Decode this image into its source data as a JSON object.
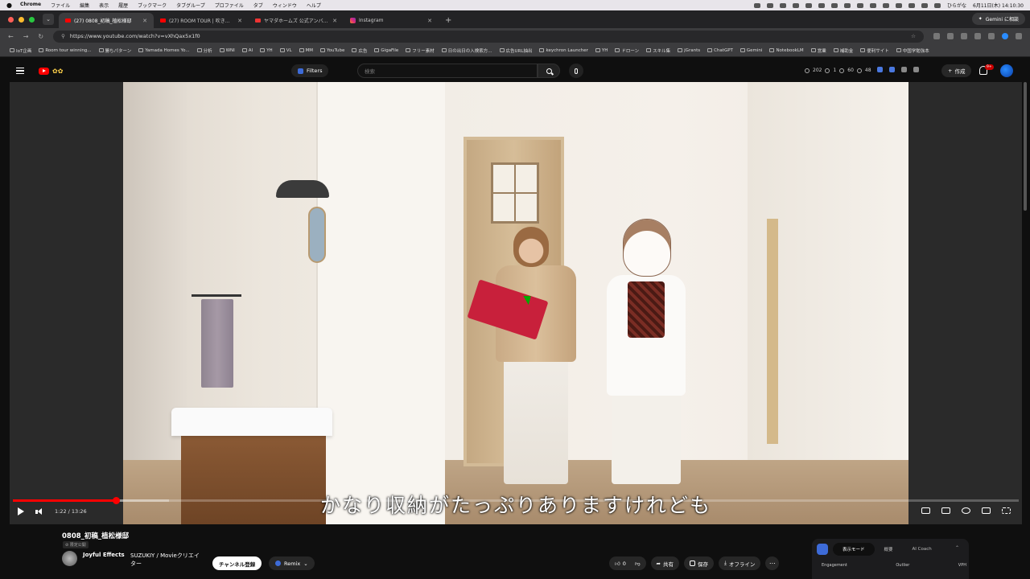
{
  "mac": {
    "app": "Chrome",
    "menus": [
      "ファイル",
      "編集",
      "表示",
      "履歴",
      "ブックマーク",
      "タブグループ",
      "プロファイル",
      "タブ",
      "ウィンドウ",
      "ヘルプ"
    ],
    "clock": "6月11日(木) 14:10:30",
    "input_mode": "ひらがな"
  },
  "tabs": [
    {
      "title": "(27) 0808_初稿_植松様邸"
    },
    {
      "title": "(27) ROOM TOUR | 吹き抜けの"
    },
    {
      "title": "ヤマダホームズ 公式アンバサダー"
    },
    {
      "title": "Instagram"
    }
  ],
  "gemini_label": "Gemini に相談",
  "url": "https://www.youtube.com/watch?v=vXhQax5x1f0",
  "bookmarks": [
    "IoT企画",
    "Room tour winning...",
    "勝ちパターン",
    "Yamada Homes Yo...",
    "分析",
    "WNI",
    "AI",
    "YH",
    "VL",
    "MM",
    "YouTube",
    "広告",
    "GigaFile",
    "フリー素材",
    "日の出日の入検索方...",
    "広告URL抽出",
    "keychron Launcher",
    "YH",
    "ドローン",
    "スキル集",
    "jGrants",
    "ChatGPT",
    "Gemini",
    "NotebookLM",
    "営業",
    "補助金",
    "便利サイト",
    "中国学勉強本"
  ],
  "youtube": {
    "filters_label": "Filters",
    "search_placeholder": "検索",
    "stats": [
      "202",
      "1",
      "60",
      "48"
    ],
    "create_label": "作成",
    "notif_count": "9+"
  },
  "player": {
    "subtitle": "かなり収納がたっぷりありますけれども",
    "time_current": "1:22",
    "time_total": "13:26",
    "time_display": "1:22 / 13:26",
    "progress_fraction": 0.102,
    "buffer_fraction": 0.155
  },
  "video": {
    "title": "0808_初稿_植松様邸",
    "visibility": "限定公開",
    "channel": "Joyful Effects",
    "channel_sub": "SUZUKIY / Movieクリエイター",
    "subscribe_label": "チャンネル登録",
    "remix_label": "Remix",
    "likes": "0",
    "share_label": "共有",
    "save_label": "保存",
    "offline_label": "オフライン"
  },
  "panel": {
    "tabs": [
      "表示モード",
      "概要",
      "AI Coach"
    ],
    "labels": [
      "Engagement",
      "Outlier",
      "VPH"
    ]
  }
}
